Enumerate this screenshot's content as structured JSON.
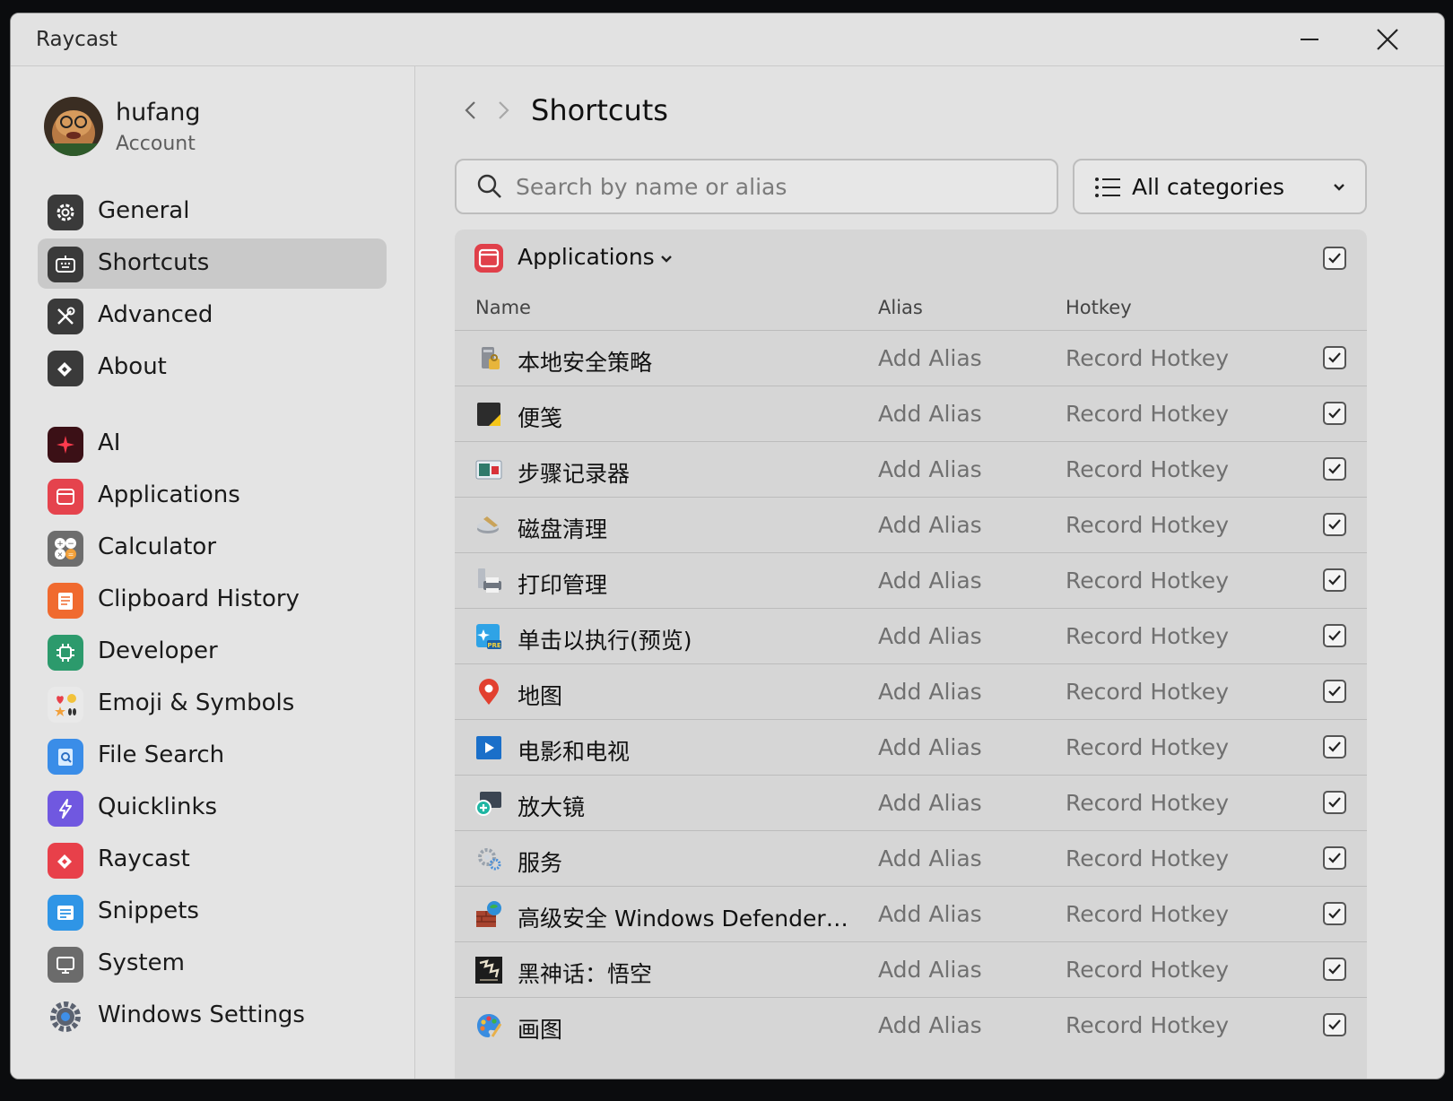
{
  "window": {
    "title": "Raycast"
  },
  "account": {
    "name": "hufang",
    "subtitle": "Account"
  },
  "sidebar": {
    "settings_items": [
      {
        "label": "General",
        "icon": "gear-icon"
      },
      {
        "label": "Shortcuts",
        "icon": "keyboard-icon",
        "active": true
      },
      {
        "label": "Advanced",
        "icon": "tools-icon"
      },
      {
        "label": "About",
        "icon": "raycast-logo-icon"
      }
    ],
    "extension_items": [
      {
        "label": "AI",
        "icon": "sparkle-icon"
      },
      {
        "label": "Applications",
        "icon": "app-window-icon"
      },
      {
        "label": "Calculator",
        "icon": "calculator-icon"
      },
      {
        "label": "Clipboard History",
        "icon": "clipboard-icon"
      },
      {
        "label": "Developer",
        "icon": "chip-icon"
      },
      {
        "label": "Emoji & Symbols",
        "icon": "emoji-icon"
      },
      {
        "label": "File Search",
        "icon": "file-search-icon"
      },
      {
        "label": "Quicklinks",
        "icon": "link-bolt-icon"
      },
      {
        "label": "Raycast",
        "icon": "raycast-icon"
      },
      {
        "label": "Snippets",
        "icon": "snippets-icon"
      },
      {
        "label": "System",
        "icon": "monitor-icon"
      },
      {
        "label": "Windows Settings",
        "icon": "windows-gear-icon"
      }
    ]
  },
  "main": {
    "title": "Shortcuts",
    "search_placeholder": "Search by name or alias",
    "category_filter": "All categories"
  },
  "group": {
    "title": "Applications",
    "columns": {
      "name": "Name",
      "alias": "Alias",
      "hotkey": "Hotkey"
    },
    "rows": [
      {
        "name": "本地安全策略",
        "alias": "Add Alias",
        "hotkey": "Record Hotkey",
        "checked": true
      },
      {
        "name": "便笺",
        "alias": "Add Alias",
        "hotkey": "Record Hotkey",
        "checked": true
      },
      {
        "name": "步骤记录器",
        "alias": "Add Alias",
        "hotkey": "Record Hotkey",
        "checked": true
      },
      {
        "name": "磁盘清理",
        "alias": "Add Alias",
        "hotkey": "Record Hotkey",
        "checked": true
      },
      {
        "name": "打印管理",
        "alias": "Add Alias",
        "hotkey": "Record Hotkey",
        "checked": true
      },
      {
        "name": "单击以执行(预览)",
        "alias": "Add Alias",
        "hotkey": "Record Hotkey",
        "checked": true
      },
      {
        "name": "地图",
        "alias": "Add Alias",
        "hotkey": "Record Hotkey",
        "checked": true
      },
      {
        "name": "电影和电视",
        "alias": "Add Alias",
        "hotkey": "Record Hotkey",
        "checked": true
      },
      {
        "name": "放大镜",
        "alias": "Add Alias",
        "hotkey": "Record Hotkey",
        "checked": true
      },
      {
        "name": "服务",
        "alias": "Add Alias",
        "hotkey": "Record Hotkey",
        "checked": true
      },
      {
        "name": "高级安全 Windows Defender ...",
        "alias": "Add Alias",
        "hotkey": "Record Hotkey",
        "checked": true
      },
      {
        "name": "黑神话：悟空",
        "alias": "Add Alias",
        "hotkey": "Record Hotkey",
        "checked": true
      },
      {
        "name": "画图",
        "alias": "Add Alias",
        "hotkey": "Record Hotkey",
        "checked": true
      }
    ]
  }
}
